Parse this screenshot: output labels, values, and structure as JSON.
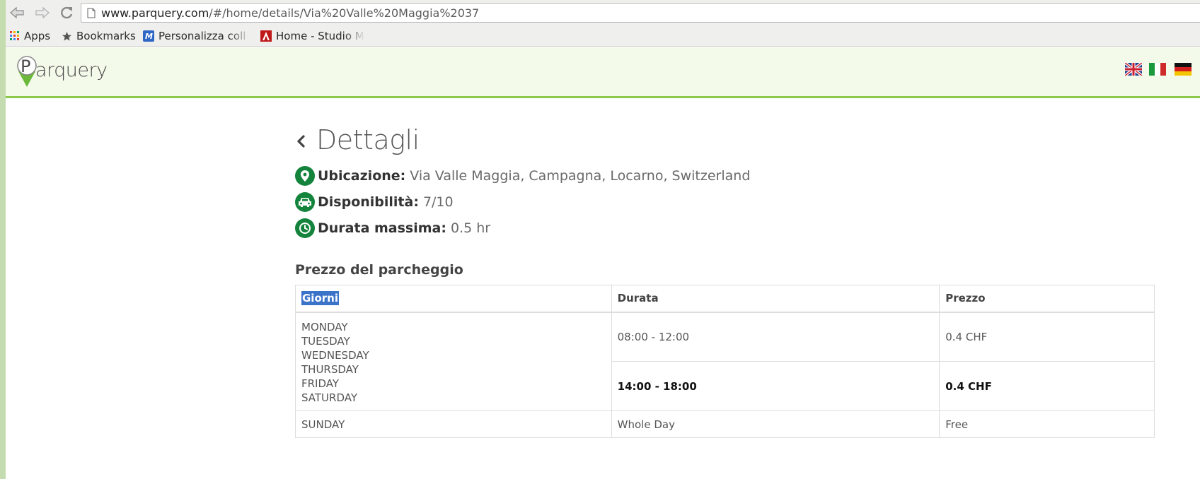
{
  "browser": {
    "url_host": "www.parquery.com",
    "url_path": "/#/home/details/Via%20Valle%20Maggia%2037",
    "bookmarks": [
      {
        "label": "Apps",
        "icon": "apps-grid-icon"
      },
      {
        "label": "Bookmarks",
        "icon": "star-icon"
      },
      {
        "label": "Personalizza coll",
        "icon": "m-logo-icon"
      },
      {
        "label": "Home - Studio M",
        "icon": "a-logo-icon"
      }
    ]
  },
  "header": {
    "logo_letter": "P",
    "logo_text": "arquery",
    "flags": [
      "uk-flag",
      "italy-flag",
      "germany-flag"
    ]
  },
  "details": {
    "title": "Dettagli",
    "location_label": "Ubicazione:",
    "location_value": "Via Valle Maggia, Campagna, Locarno, Switzerland",
    "availability_label": "Disponibilità:",
    "availability_value": "7/10",
    "max_duration_label": "Durata massima:",
    "max_duration_value": "0.5 hr"
  },
  "pricing": {
    "heading": "Prezzo del parcheggio",
    "columns": [
      "Giorni",
      "Durata",
      "Prezzo"
    ],
    "weekday_days": [
      "MONDAY",
      "TUESDAY",
      "WEDNESDAY",
      "THURSDAY",
      "FRIDAY",
      "SATURDAY"
    ],
    "weekday_slots": [
      {
        "duration": "08:00 - 12:00",
        "price": "0.4 CHF"
      },
      {
        "duration": "14:00 - 18:00",
        "price": "0.4 CHF"
      }
    ],
    "sunday": {
      "day": "SUNDAY",
      "duration": "Whole Day",
      "price": "Free"
    }
  },
  "colors": {
    "brand_green": "#14843d",
    "header_bg": "#f3faea",
    "header_border": "#8cc84b",
    "selection": "#3b73c9"
  }
}
